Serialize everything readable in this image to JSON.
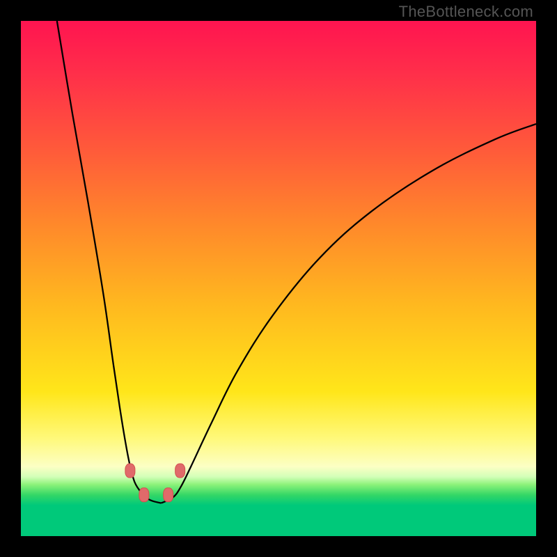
{
  "watermark": "TheBottleneck.com",
  "chart_data": {
    "type": "line",
    "title": "",
    "xlabel": "",
    "ylabel": "",
    "xlim": [
      0,
      100
    ],
    "ylim": [
      0,
      100
    ],
    "gradient_stops": [
      {
        "pos": 0,
        "color": "#ff1450"
      },
      {
        "pos": 10,
        "color": "#ff2e4a"
      },
      {
        "pos": 25,
        "color": "#ff5a3a"
      },
      {
        "pos": 40,
        "color": "#ff8a2a"
      },
      {
        "pos": 55,
        "color": "#ffb81f"
      },
      {
        "pos": 72,
        "color": "#ffe61a"
      },
      {
        "pos": 81,
        "color": "#fff97a"
      },
      {
        "pos": 86.5,
        "color": "#fcffc4"
      },
      {
        "pos": 88.5,
        "color": "#d2ffb8"
      },
      {
        "pos": 90,
        "color": "#8cf27a"
      },
      {
        "pos": 92,
        "color": "#34d766"
      },
      {
        "pos": 94,
        "color": "#00c97a"
      },
      {
        "pos": 100,
        "color": "#00c97a"
      }
    ],
    "series": [
      {
        "name": "left-branch",
        "x": [
          7,
          10,
          13,
          16,
          18,
          19.5,
          20.7,
          21.6,
          22.6,
          24.7,
          27.2
        ],
        "y": [
          100,
          82,
          65,
          47,
          33,
          23,
          16,
          12,
          9.5,
          7.2,
          6.4
        ]
      },
      {
        "name": "right-branch",
        "x": [
          27.2,
          29.5,
          31,
          33,
          37,
          42,
          49,
          58,
          68,
          80,
          92,
          100
        ],
        "y": [
          6.4,
          7.5,
          9.5,
          13.5,
          22,
          32,
          43,
          54,
          63,
          71,
          77,
          80
        ]
      }
    ],
    "markers": [
      {
        "x": 21.2,
        "y": 12.7
      },
      {
        "x": 23.9,
        "y": 8.0
      },
      {
        "x": 28.6,
        "y": 8.0
      },
      {
        "x": 30.9,
        "y": 12.7
      }
    ],
    "valley_x": 26.5,
    "valley_y": 6.4
  }
}
